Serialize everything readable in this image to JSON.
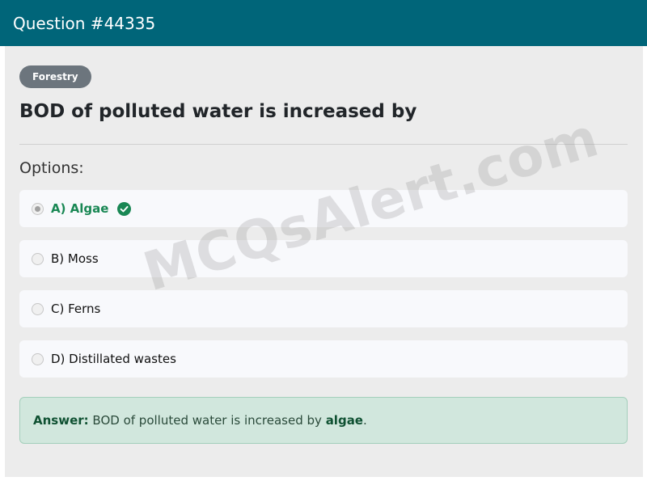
{
  "header": {
    "title": "Question #44335"
  },
  "question": {
    "category": "Forestry",
    "text": "BOD of polluted water is increased by"
  },
  "options_label": "Options:",
  "options": [
    {
      "label": "A) Algae",
      "selected": true,
      "correct": true
    },
    {
      "label": "B) Moss",
      "selected": false,
      "correct": false
    },
    {
      "label": "C) Ferns",
      "selected": false,
      "correct": false
    },
    {
      "label": "D) Distillated wastes",
      "selected": false,
      "correct": false
    }
  ],
  "answer": {
    "prefix": "Answer:",
    "text": " BOD of polluted water is increased by ",
    "highlight": "algae",
    "suffix": "."
  },
  "watermark": "MCQsAlert.com",
  "colors": {
    "header_bg": "#006579",
    "correct_green": "#198754",
    "answer_bg": "#d1e7dd",
    "badge_bg": "#6c757d"
  }
}
